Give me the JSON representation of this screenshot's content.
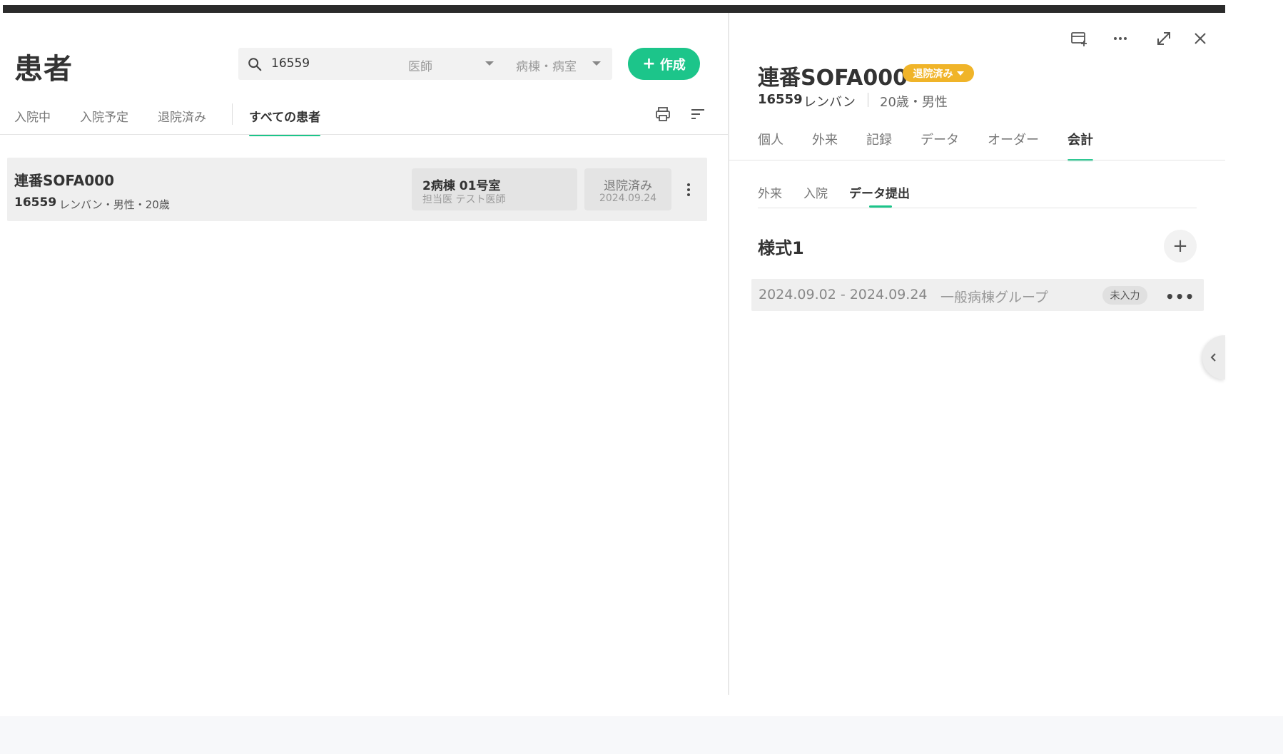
{
  "left_panel": {
    "title": "患者",
    "search": {
      "value": "16559"
    },
    "filters": {
      "doctor": "医師",
      "ward": "病棟・病室"
    },
    "create_button": "作成",
    "tabs": [
      {
        "label": "入院中",
        "active": false
      },
      {
        "label": "入院予定",
        "active": false
      },
      {
        "label": "退院済み",
        "active": false
      },
      {
        "label": "すべての患者",
        "active": true
      }
    ],
    "patients": [
      {
        "name": "連番SOFA000",
        "id": "16559",
        "details": "レンバン・男性・20歳",
        "room": "2病棟 01号室",
        "doctor": "担当医 テスト医師",
        "status": "退院済み",
        "date": "2024.09.24"
      }
    ]
  },
  "right_panel": {
    "title": "連番SOFA000",
    "status_badge": "退院済み",
    "patient_id": "16559",
    "patient_name": "レンバン",
    "age_gender": "20歳・男性",
    "tabs": [
      {
        "label": "個人",
        "active": false
      },
      {
        "label": "外来",
        "active": false
      },
      {
        "label": "記録",
        "active": false
      },
      {
        "label": "データ",
        "active": false
      },
      {
        "label": "オーダー",
        "active": false
      },
      {
        "label": "会計",
        "active": true
      }
    ],
    "sub_tabs": [
      {
        "label": "外来",
        "active": false
      },
      {
        "label": "入院",
        "active": false
      },
      {
        "label": "データ提出",
        "active": true
      }
    ],
    "section_title": "様式1",
    "records": [
      {
        "date_range": "2024.09.02 - 2024.09.24",
        "group": "一般病棟グループ",
        "status": "未入力"
      }
    ]
  },
  "colors": {
    "accent": "#1cc58a",
    "badge": "#f0b429"
  }
}
